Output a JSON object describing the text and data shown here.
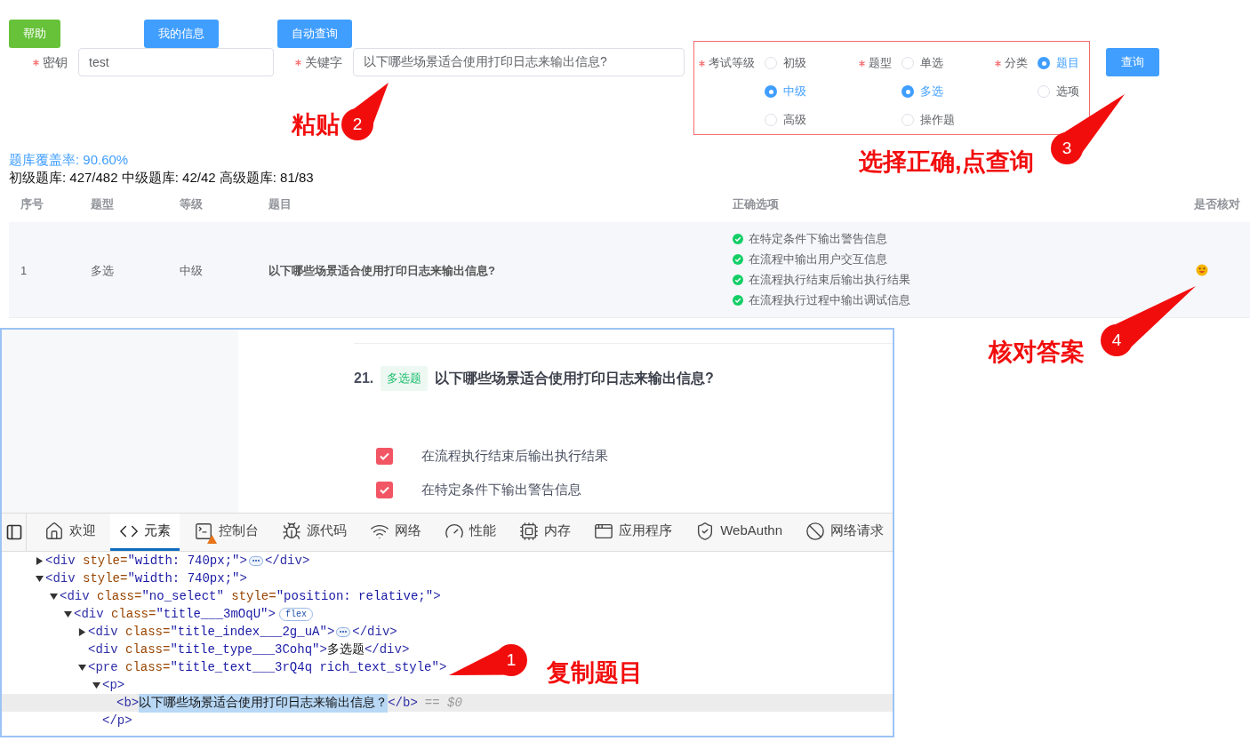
{
  "top_buttons": [
    {
      "label": "帮助",
      "kind": "help"
    },
    {
      "label": "我的信息",
      "kind": "primary"
    },
    {
      "label": "自动查询",
      "kind": "primary"
    }
  ],
  "fields": [
    {
      "label": "密钥",
      "required": true,
      "value": "test"
    },
    {
      "label": "关键字",
      "required": true,
      "value": "以下哪些场景适合使用打印日志来输出信息?"
    }
  ],
  "filters": [
    {
      "label": "考试等级",
      "required": true,
      "options": [
        {
          "label": "初级",
          "selected": false
        },
        {
          "label": "中级",
          "selected": true
        },
        {
          "label": "高级",
          "selected": false
        }
      ]
    },
    {
      "label": "题型",
      "required": true,
      "options": [
        {
          "label": "单选",
          "selected": false
        },
        {
          "label": "多选",
          "selected": true
        },
        {
          "label": "操作题",
          "selected": false
        }
      ]
    },
    {
      "label": "分类",
      "required": true,
      "options": [
        {
          "label": "题目",
          "selected": true
        },
        {
          "label": "选项",
          "selected": false
        }
      ]
    }
  ],
  "query_button": "查询",
  "coverage": "题库覆盖率: 90.60%",
  "stats": "初级题库: 427/482 中级题库: 42/42 高级题库: 81/83",
  "table": {
    "columns": [
      "序号",
      "题型",
      "等级",
      "题目",
      "正确选项",
      "是否核对"
    ],
    "rows": [
      {
        "index": "1",
        "type": "多选",
        "level": "中级",
        "question": "以下哪些场景适合使用打印日志来输出信息?",
        "correct_options": [
          "在特定条件下输出警告信息",
          "在流程中输出用户交互信息",
          "在流程执行结束后输出执行结果",
          "在流程执行过程中输出调试信息"
        ],
        "verified": true
      }
    ]
  },
  "exam_page": {
    "number": "21.",
    "tag": "多选题",
    "title": "以下哪些场景适合使用打印日志来输出信息?",
    "options": [
      {
        "text": "在流程执行结束后输出执行结果",
        "checked": true
      },
      {
        "text": "在特定条件下输出警告信息",
        "checked": true
      }
    ]
  },
  "devtools": {
    "tabs": [
      {
        "label": "欢迎",
        "kind": "home",
        "selected": false,
        "warning": false
      },
      {
        "label": "元素",
        "kind": "code",
        "selected": true,
        "warning": false
      },
      {
        "label": "控制台",
        "kind": "console",
        "selected": false,
        "warning": true
      },
      {
        "label": "源代码",
        "kind": "bug",
        "selected": false,
        "warning": false
      },
      {
        "label": "网络",
        "kind": "wifi",
        "selected": false,
        "warning": false
      },
      {
        "label": "性能",
        "kind": "gauge",
        "selected": false,
        "warning": false
      },
      {
        "label": "内存",
        "kind": "cpu",
        "selected": false,
        "warning": false
      },
      {
        "label": "应用程序",
        "kind": "app",
        "selected": false,
        "warning": false
      },
      {
        "label": "WebAuthn",
        "kind": "shield",
        "selected": false,
        "warning": false
      },
      {
        "label": "网络请求",
        "kind": "block",
        "selected": false,
        "warning": false
      }
    ],
    "dom_tree": [
      {
        "open": "<div style=\"width: 740px;\">",
        "expanded": false,
        "close": "</div>",
        "selected": false
      },
      {
        "open": "<div style=\"width: 740px;\">",
        "expanded": true,
        "selected": false,
        "children": [
          {
            "open": "<div class=\"no_select\" style=\"position: relative;\">",
            "expanded": true,
            "selected": false,
            "children": [
              {
                "open": "<div class=\"title___3mOqU\">",
                "badge": "flex",
                "expanded": true,
                "selected": false,
                "children": [
                  {
                    "open": "<div class=\"title_index___2g_uA\">",
                    "expanded": false,
                    "close": "</div>",
                    "selected": false
                  },
                  {
                    "open": "<div class=\"title_type___3Cohq\">",
                    "content": "多选题",
                    "close": "</div>",
                    "selected": false
                  },
                  {
                    "open": "<pre class=\"title_text___3rQ4q rich_text_style\">",
                    "expanded": true,
                    "selected": false,
                    "children": [
                      {
                        "open": "<p>",
                        "expanded": true,
                        "selected": false,
                        "end_line": "</p>",
                        "children": [
                          {
                            "open": "<b>",
                            "content": "以下哪些场景适合使用打印日志来输出信息？",
                            "close": "</b>",
                            "selected": true,
                            "suffix": "== $0"
                          }
                        ]
                      }
                    ]
                  }
                ]
              }
            ]
          }
        ]
      }
    ]
  },
  "annotations": [
    {
      "number": "1",
      "label": "复制题目"
    },
    {
      "number": "2",
      "label": "粘贴"
    },
    {
      "number": "3",
      "label": "选择正确,点查询"
    },
    {
      "number": "4",
      "label": "核对答案"
    }
  ]
}
